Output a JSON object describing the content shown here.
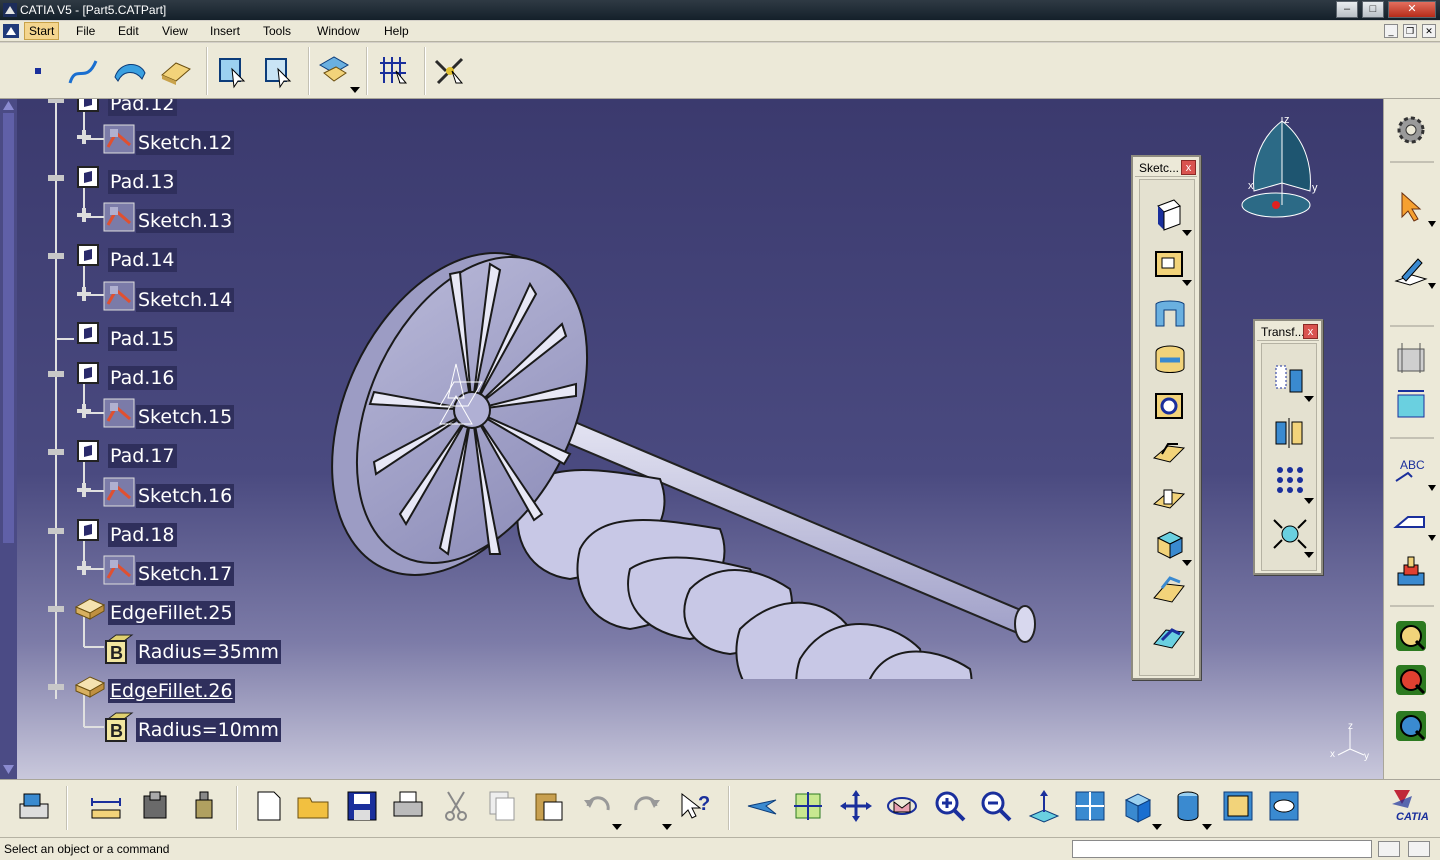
{
  "window": {
    "title": "CATIA V5 - [Part5.CATPart]",
    "min_label": "–",
    "max_label": "□",
    "close_label": "✕"
  },
  "menu": {
    "start": "Start",
    "file": "File",
    "edit": "Edit",
    "view": "View",
    "insert": "Insert",
    "tools": "Tools",
    "window": "Window",
    "help": "Help"
  },
  "tree": [
    {
      "label": "Pad.12",
      "kind": "pad"
    },
    {
      "label": "Sketch.12",
      "kind": "sketch"
    },
    {
      "label": "Pad.13",
      "kind": "pad"
    },
    {
      "label": "Sketch.13",
      "kind": "sketch"
    },
    {
      "label": "Pad.14",
      "kind": "pad"
    },
    {
      "label": "Sketch.14",
      "kind": "sketch"
    },
    {
      "label": "Pad.15",
      "kind": "pad"
    },
    {
      "label": "Pad.16",
      "kind": "pad"
    },
    {
      "label": "Sketch.15",
      "kind": "sketch"
    },
    {
      "label": "Pad.17",
      "kind": "pad"
    },
    {
      "label": "Sketch.16",
      "kind": "sketch"
    },
    {
      "label": "Pad.18",
      "kind": "pad"
    },
    {
      "label": "Sketch.17",
      "kind": "sketch"
    },
    {
      "label": "EdgeFillet.25",
      "kind": "fillet"
    },
    {
      "label": "Radius=35mm",
      "kind": "param"
    },
    {
      "label": "EdgeFillet.26",
      "kind": "fillet"
    },
    {
      "label": "Radius=10mm",
      "kind": "param"
    }
  ],
  "palettes": {
    "sketch_based": {
      "title": "Sketc..."
    },
    "transformation": {
      "title": "Transf..."
    },
    "close_label": "x"
  },
  "compass": {
    "x_label": "x",
    "y_label": "y",
    "z_label": "z"
  },
  "axis_triad": {
    "x_label": "x",
    "y_label": "y",
    "z_label": "z"
  },
  "logo": {
    "text": "CATIA"
  },
  "status": {
    "message": "Select an object or a command",
    "command_input": ""
  },
  "colors": {
    "viewport_top": "#3b3a6e",
    "viewport_bottom": "#c9c8dc",
    "part_fill": "#c8c8e6",
    "tree_label_bg": "#2f2f5c"
  }
}
